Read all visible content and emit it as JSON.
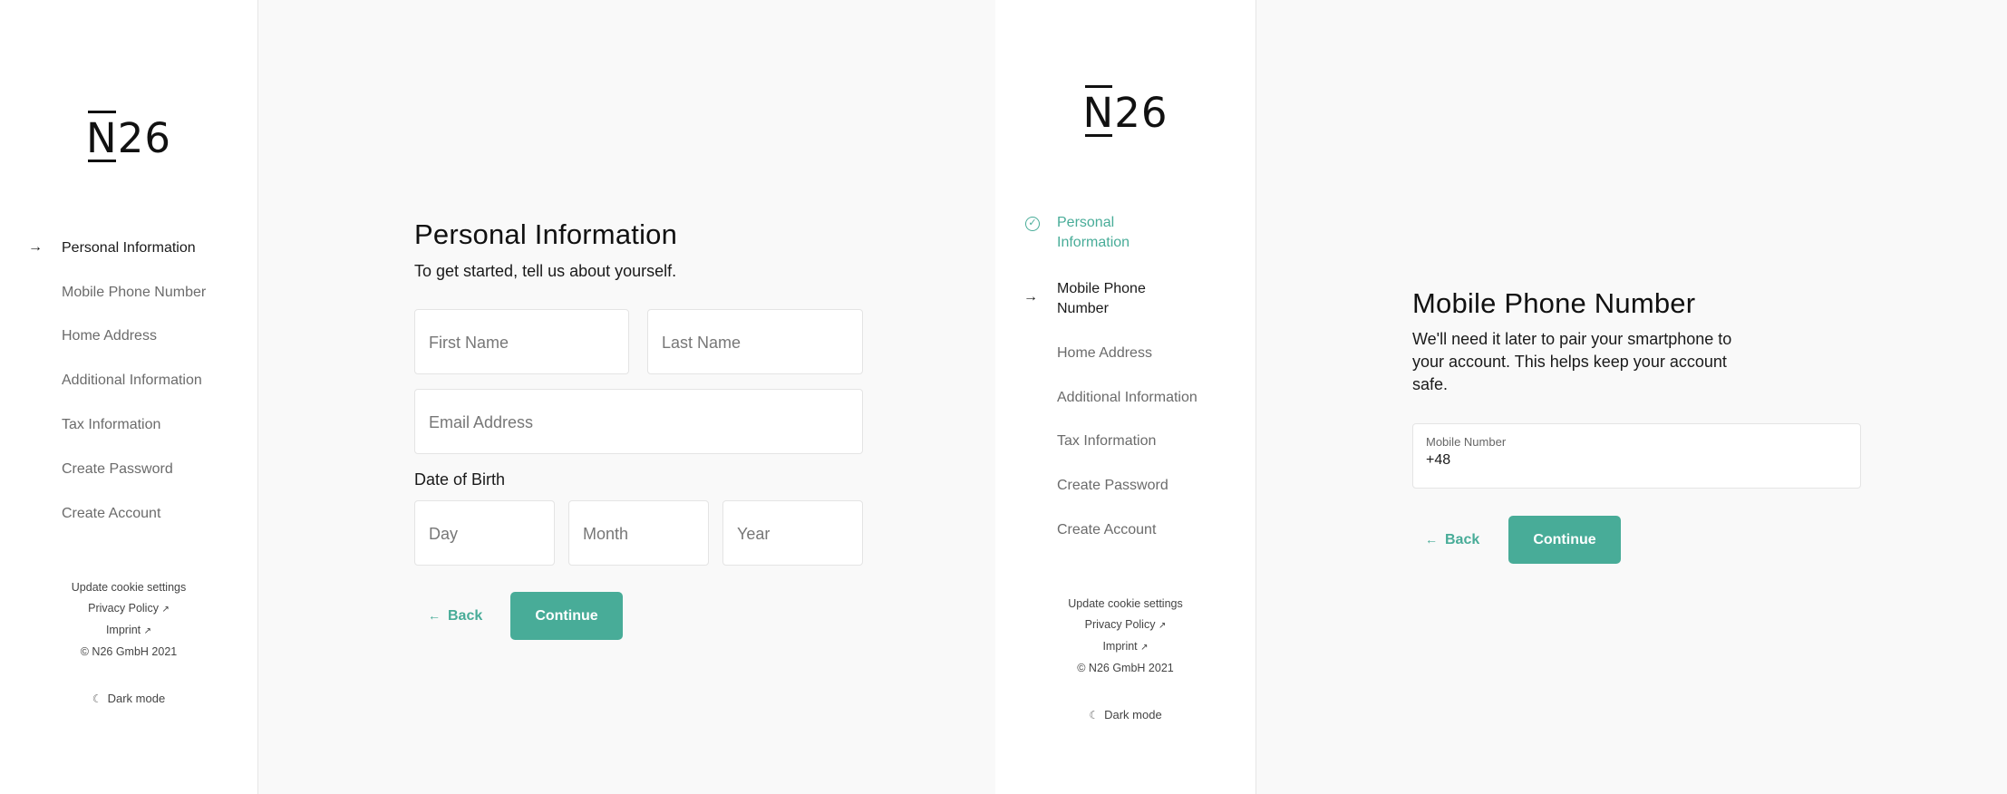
{
  "logo": {
    "n": "N",
    "rest": "26"
  },
  "screen1": {
    "steps": [
      {
        "label": "Personal Information",
        "marker": "→"
      },
      {
        "label": "Mobile Phone Number"
      },
      {
        "label": "Home Address"
      },
      {
        "label": "Additional Information"
      },
      {
        "label": "Tax Information"
      },
      {
        "label": "Create Password"
      },
      {
        "label": "Create Account"
      }
    ],
    "title": "Personal Information",
    "subtitle": "To get started, tell us about yourself.",
    "first_name_placeholder": "First Name",
    "last_name_placeholder": "Last Name",
    "email_placeholder": "Email Address",
    "dob_label": "Date of Birth",
    "day_placeholder": "Day",
    "month_placeholder": "Month",
    "year_placeholder": "Year",
    "back_label": "Back",
    "continue_label": "Continue"
  },
  "screen2": {
    "steps": [
      {
        "label1": "Personal",
        "label2": "Information",
        "marker": "✓"
      },
      {
        "label1": "Mobile Phone",
        "label2": "Number",
        "marker": "→"
      },
      {
        "label": "Home Address"
      },
      {
        "label": "Additional Information"
      },
      {
        "label": "Tax Information"
      },
      {
        "label": "Create Password"
      },
      {
        "label": "Create Account"
      }
    ],
    "title": "Mobile Phone Number",
    "subtitle1": "We'll need it later to pair your smartphone to",
    "subtitle2": "your account. This helps keep your account",
    "subtitle3": "safe.",
    "mobile_label": "Mobile Number",
    "mobile_value": "+48",
    "back_label": "Back",
    "continue_label": "Continue"
  },
  "footer": {
    "cookie": "Update cookie settings",
    "privacy": "Privacy Policy",
    "imprint": "Imprint",
    "copyright": "© N26 GmbH 2021",
    "ext_icon": "↗",
    "dark_mode": "Dark mode",
    "moon_icon": "☾"
  },
  "icons": {
    "back_arrow": "←"
  },
  "colors": {
    "accent": "#48ac98",
    "sidebar_bg": "#ffffff",
    "page_bg": "#f9f9f9"
  }
}
